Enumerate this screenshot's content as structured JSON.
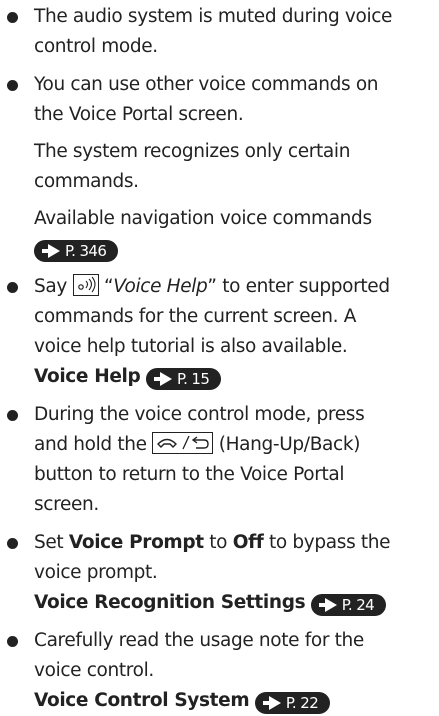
{
  "bullets": [
    {
      "lines": [
        "The audio system is muted during voice",
        "control mode."
      ]
    },
    {
      "lines": [
        "You can use other voice commands on",
        "the Voice Portal screen."
      ],
      "para2": [
        "The system recognizes only certain",
        "commands."
      ],
      "para3": [
        "Available navigation voice commands"
      ],
      "ref": "P. 346"
    },
    {
      "say": "Say",
      "quote": "Voice Help",
      "after": "to enter supported",
      "lines": [
        "commands for the current screen. A",
        "voice help tutorial is also available."
      ],
      "link_label": "Voice Help",
      "ref": "P. 15"
    },
    {
      "line1": "During the voice control mode, press",
      "line2_a": "and hold the",
      "line2_b": "(Hang-Up/Back)",
      "lines": [
        "button to return to the Voice Portal",
        "screen."
      ]
    },
    {
      "set": "Set",
      "bold1": "Voice Prompt",
      "to": "to",
      "bold2": "Off",
      "after": "to bypass the",
      "line2": "voice prompt.",
      "link_label": "Voice Recognition Settings",
      "ref": "P. 24"
    },
    {
      "lines": [
        "Carefully read the usage note for the",
        "voice control."
      ],
      "link_label": "Voice Control System",
      "ref": "P. 22"
    }
  ],
  "icons": {
    "talk": "talk-button-icon",
    "hangup": "hang-up-back-button-icon",
    "ref": "page-reference-arrow-icon"
  }
}
